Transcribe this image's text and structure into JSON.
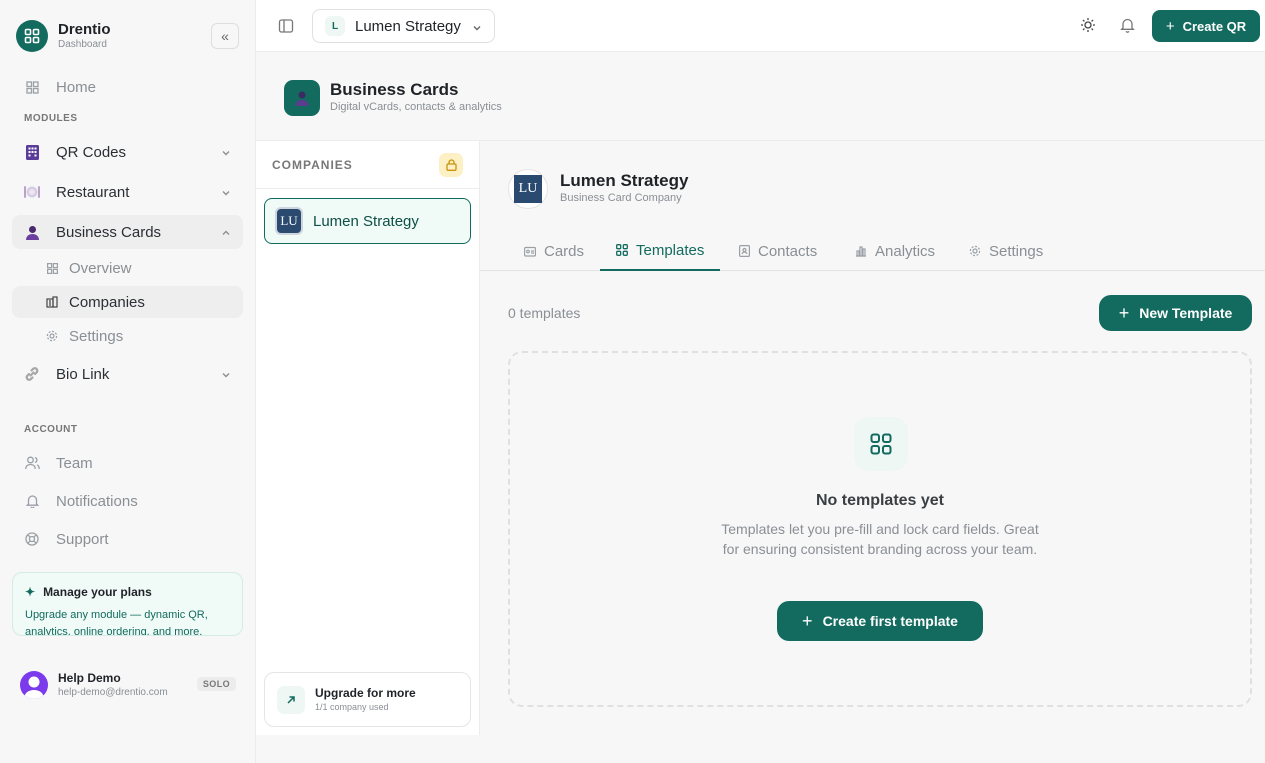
{
  "brand": {
    "name": "Drentio",
    "subtitle": "Dashboard",
    "collapse": "«"
  },
  "nav": {
    "home": "Home",
    "modules_label": "MODULES",
    "qr_codes": "QR Codes",
    "restaurant": "Restaurant",
    "business_cards": "Business Cards",
    "sub": {
      "overview": "Overview",
      "companies": "Companies",
      "settings": "Settings"
    },
    "bio_link": "Bio Link",
    "account_label": "ACCOUNT",
    "team": "Team",
    "notifications": "Notifications",
    "support": "Support"
  },
  "plans": {
    "title": "Manage your plans",
    "text": "Upgrade any module — dynamic QR, analytics, online ordering, and more."
  },
  "user": {
    "name": "Help Demo",
    "email": "help-demo@drentio.com",
    "plan": "SOLO"
  },
  "topbar": {
    "company_initial": "L",
    "company_name": "Lumen Strategy",
    "create_qr": "Create QR"
  },
  "page": {
    "title": "Business Cards",
    "subtitle": "Digital vCards, contacts & analytics"
  },
  "companies": {
    "label": "COMPANIES",
    "items": [
      {
        "initials": "LU",
        "name": "Lumen Strategy"
      }
    ],
    "upgrade_title": "Upgrade for more",
    "upgrade_sub": "1/1 company used"
  },
  "detail": {
    "initials": "LU",
    "name": "Lumen Strategy",
    "type": "Business Card Company",
    "tabs": [
      "Cards",
      "Templates",
      "Contacts",
      "Analytics",
      "Settings"
    ],
    "active_tab": "Templates",
    "count": "0 templates",
    "new_template": "New Template",
    "empty_title": "No templates yet",
    "empty_text": "Templates let you pre-fill and lock card fields. Great for ensuring consistent branding across your team.",
    "create_first": "Create first template"
  },
  "colors": {
    "accent": "#126b5e",
    "accent_light": "#f0faf7",
    "lock_bg": "#fdf0c4",
    "avatar": "#7c3aed"
  }
}
